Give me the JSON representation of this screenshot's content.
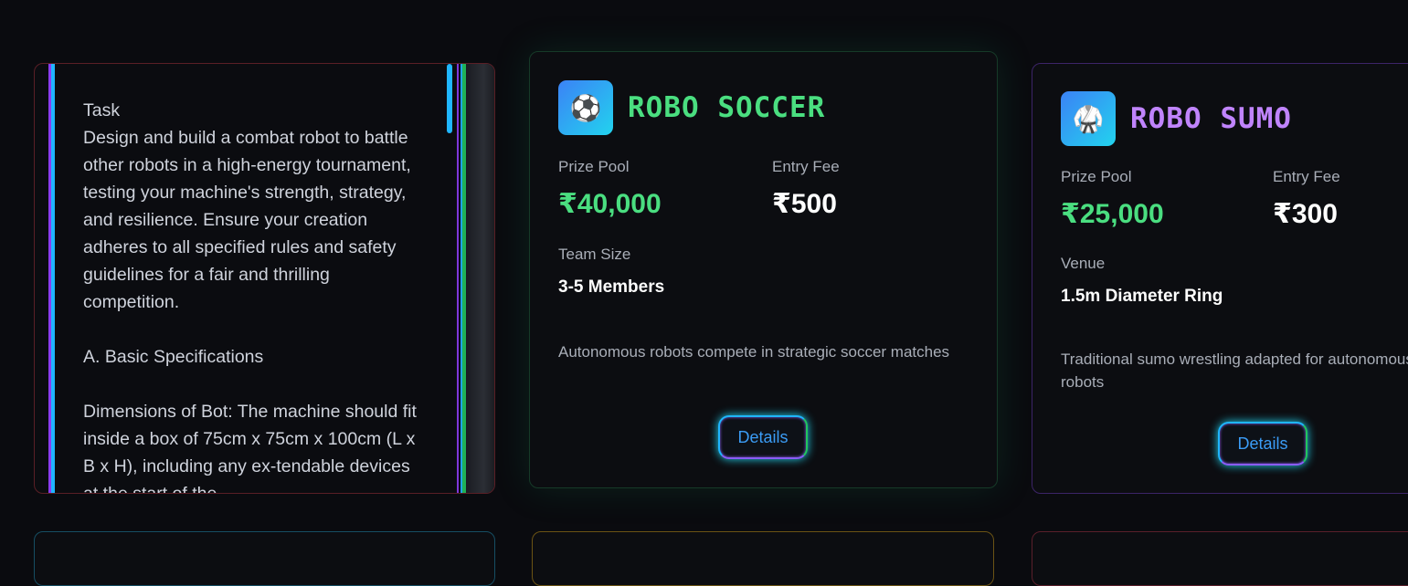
{
  "task_panel": {
    "heading": "Task",
    "body": "Design and build a combat robot to battle other robots in a high-energy tournament, testing your machine's strength, strategy, and resilience. Ensure your creation adheres to all specified rules and safety guidelines for a fair and thrilling competition.",
    "section_title": "A. Basic Specifications",
    "section_body": "Dimensions of Bot: The machine should fit inside a box of 75cm x 75cm x 100cm (L x B x H), including any ex-tendable devices at the start of the"
  },
  "events": [
    {
      "icon": "⚽",
      "icon_name": "soccer-ball-icon",
      "title": "ROBO SOCCER",
      "title_color": "#4ade80",
      "prize_label": "Prize Pool",
      "prize": "₹40,000",
      "fee_label": "Entry Fee",
      "fee": "₹500",
      "info_label": "Team Size",
      "info_value": "3-5 Members",
      "description": "Autonomous robots compete in strategic soccer matches",
      "button_label": "Details"
    },
    {
      "icon": "🥋",
      "icon_name": "martial-arts-uniform-icon",
      "title": "ROBO SUMO",
      "title_color": "#c084fc",
      "prize_label": "Prize Pool",
      "prize": "₹25,000",
      "fee_label": "Entry Fee",
      "fee": "₹300",
      "info_label": "Venue",
      "info_value": "1.5m Diameter Ring",
      "description": "Traditional sumo wrestling adapted for autonomous robots",
      "button_label": "Details"
    }
  ],
  "colors": {
    "prize": "#4ade80",
    "accent_cyan": "#22d3ee",
    "accent_purple": "#8b5cf6",
    "bottom_borders": [
      "#164e63",
      "#6b5314",
      "#5a1f2b"
    ]
  }
}
